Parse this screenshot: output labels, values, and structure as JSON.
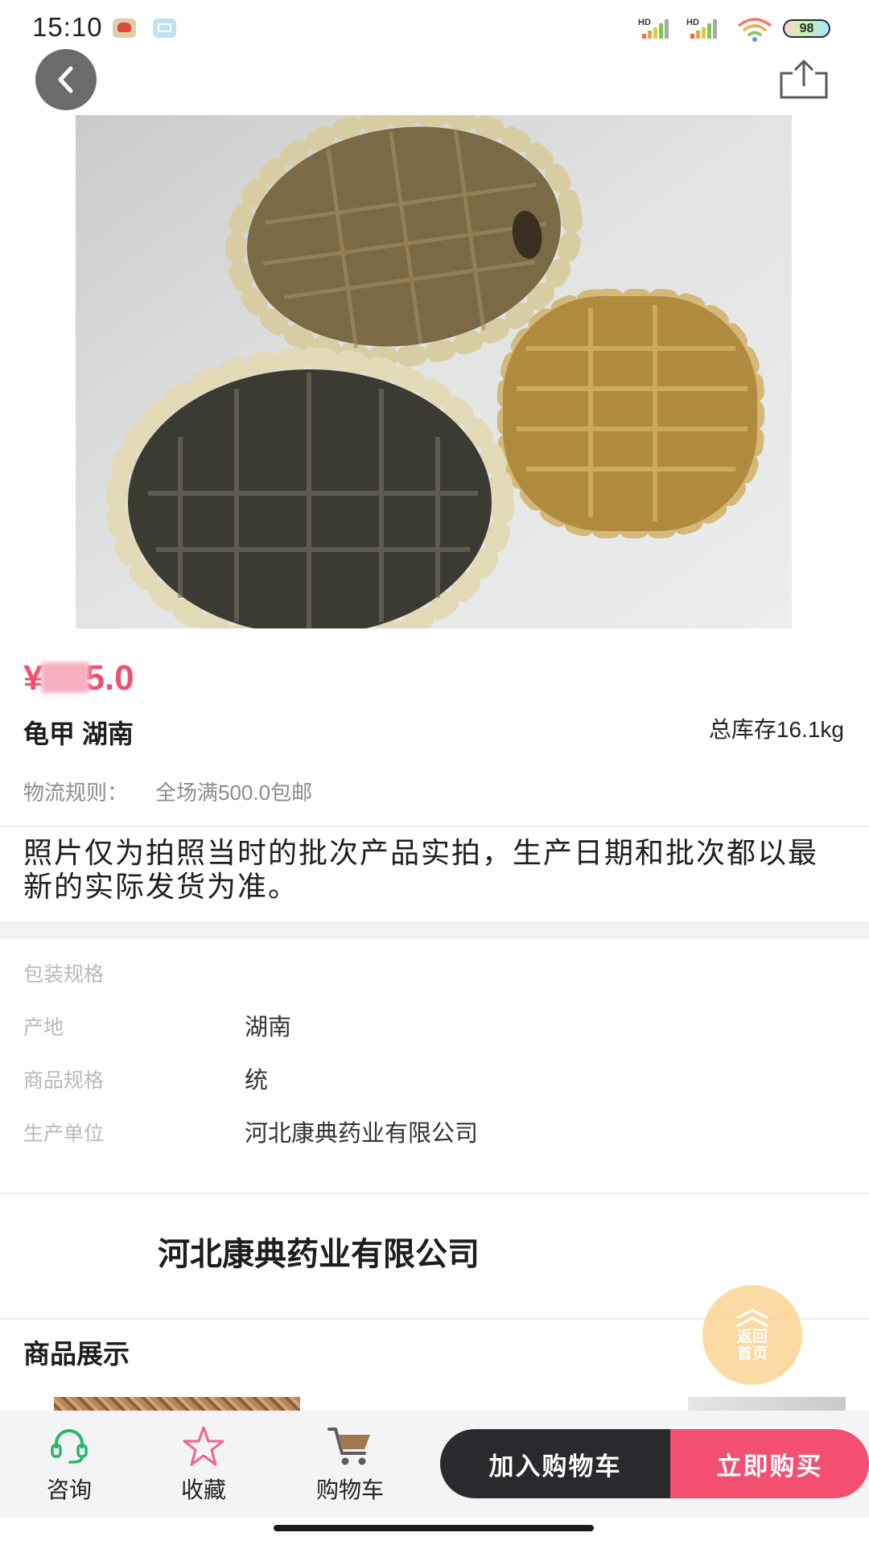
{
  "status_bar": {
    "time": "15:10",
    "network_1": "HD",
    "network_2": "HD",
    "battery": "98"
  },
  "icons": {
    "back": "chevron-left-icon",
    "share": "share-icon",
    "consult": "headset-icon",
    "favorite": "star-icon",
    "cart": "cart-icon",
    "float_home": "double-chevron-up-icon"
  },
  "product": {
    "price_symbol": "¥",
    "price_tail": "5.0",
    "name": "龟甲 湖南",
    "stock": "总库存16.1kg",
    "shipping_label": "物流规则：",
    "shipping_rule": "全场满500.0包邮",
    "notice": "照片仅为拍照当时的批次产品实拍，生产日期和批次都以最新的实际发货为准。"
  },
  "specs": [
    {
      "label": "包装规格",
      "value": ""
    },
    {
      "label": "产地",
      "value": "湖南"
    },
    {
      "label": "商品规格",
      "value": "统"
    },
    {
      "label": "生产单位",
      "value": "河北康典药业有限公司"
    }
  ],
  "company": {
    "name": "河北康典药业有限公司"
  },
  "showcase": {
    "title": "商品展示"
  },
  "float_home": {
    "label": "返回首页"
  },
  "bottom_bar": {
    "consult": "咨询",
    "favorite": "收藏",
    "cart": "购物车",
    "add_to_cart": "加入购物车",
    "buy_now": "立即购买"
  },
  "colors": {
    "price": "#f0506e",
    "add_to_cart_bg": "#2a2a2e",
    "buy_now_bg": "#f34f70",
    "consult_icon": "#2cb56a",
    "favorite_icon": "#f06488",
    "float_home_bg": "#fad08a"
  }
}
